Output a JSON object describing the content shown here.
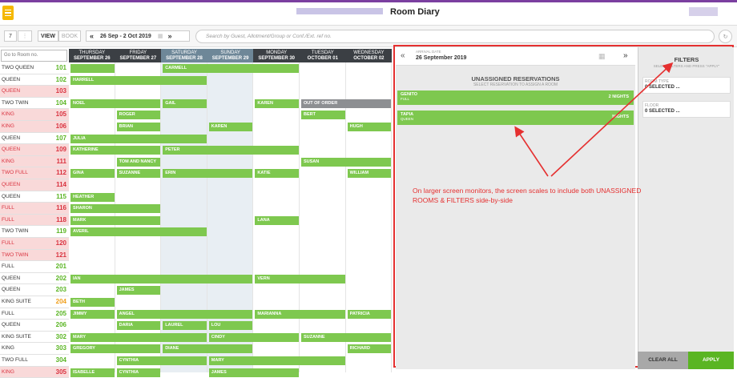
{
  "app": {
    "title": "Room Diary"
  },
  "toolbar": {
    "count": "7",
    "view": "VIEW",
    "book": "BOOK",
    "date_range": "26 Sep - 2 Oct 2019",
    "search_placeholder": "Go to Room no.",
    "search_main": "Search by Guest, Allotment/Group or Conf./Ext. ref no."
  },
  "days": [
    {
      "d": "THURSDAY",
      "n": "SEPTEMBER 26",
      "wk": false
    },
    {
      "d": "FRIDAY",
      "n": "SEPTEMBER 27",
      "wk": false
    },
    {
      "d": "SATURDAY",
      "n": "SEPTEMBER 28",
      "wk": true
    },
    {
      "d": "SUNDAY",
      "n": "SEPTEMBER 29",
      "wk": true
    },
    {
      "d": "MONDAY",
      "n": "SEPTEMBER 30",
      "wk": false
    },
    {
      "d": "TUESDAY",
      "n": "OCTOBER 01",
      "wk": false
    },
    {
      "d": "WEDNESDAY",
      "n": "OCTOBER 02",
      "wk": false
    }
  ],
  "rooms": [
    {
      "t": "TWO QUEEN",
      "n": "101",
      "c": "g",
      "d": false
    },
    {
      "t": "QUEEN",
      "n": "102",
      "c": "g",
      "d": false
    },
    {
      "t": "QUEEN",
      "n": "103",
      "c": "r",
      "d": true
    },
    {
      "t": "TWO TWIN",
      "n": "104",
      "c": "g",
      "d": false
    },
    {
      "t": "KING",
      "n": "105",
      "c": "r",
      "d": true
    },
    {
      "t": "KING",
      "n": "106",
      "c": "r",
      "d": true
    },
    {
      "t": "QUEEN",
      "n": "107",
      "c": "g",
      "d": false
    },
    {
      "t": "QUEEN",
      "n": "109",
      "c": "r",
      "d": true
    },
    {
      "t": "KING",
      "n": "111",
      "c": "r",
      "d": true
    },
    {
      "t": "TWO FULL",
      "n": "112",
      "c": "r",
      "d": true
    },
    {
      "t": "QUEEN",
      "n": "114",
      "c": "r",
      "d": true
    },
    {
      "t": "QUEEN",
      "n": "115",
      "c": "g",
      "d": false
    },
    {
      "t": "FULL",
      "n": "116",
      "c": "r",
      "d": true
    },
    {
      "t": "FULL",
      "n": "118",
      "c": "r",
      "d": true
    },
    {
      "t": "TWO TWIN",
      "n": "119",
      "c": "g",
      "d": false
    },
    {
      "t": "FULL",
      "n": "120",
      "c": "r",
      "d": true
    },
    {
      "t": "TWO TWIN",
      "n": "121",
      "c": "r",
      "d": true
    },
    {
      "t": "FULL",
      "n": "201",
      "c": "g",
      "d": false
    },
    {
      "t": "QUEEN",
      "n": "202",
      "c": "g",
      "d": false
    },
    {
      "t": "QUEEN",
      "n": "203",
      "c": "g",
      "d": false
    },
    {
      "t": "KING SUITE",
      "n": "204",
      "c": "o",
      "d": false
    },
    {
      "t": "FULL",
      "n": "205",
      "c": "g",
      "d": false
    },
    {
      "t": "QUEEN",
      "n": "206",
      "c": "g",
      "d": false
    },
    {
      "t": "KING SUITE",
      "n": "302",
      "c": "g",
      "d": false
    },
    {
      "t": "KING",
      "n": "303",
      "c": "g",
      "d": false
    },
    {
      "t": "TWO FULL",
      "n": "304",
      "c": "g",
      "d": false
    },
    {
      "t": "KING",
      "n": "305",
      "c": "r",
      "d": true
    }
  ],
  "bookings": [
    {
      "r": 0,
      "s": 0,
      "e": 1,
      "g": "",
      "x": 5
    },
    {
      "r": 0,
      "s": 2,
      "e": 5,
      "g": "CARMELL"
    },
    {
      "r": 1,
      "s": 0,
      "e": 3,
      "g": "HARRELL"
    },
    {
      "r": 3,
      "s": 0,
      "e": 2,
      "g": "NOEL"
    },
    {
      "r": 3,
      "s": 2,
      "e": 3,
      "g": "GAIL"
    },
    {
      "r": 3,
      "s": 4,
      "e": 5,
      "g": "KAREN"
    },
    {
      "r": 3,
      "s": 5,
      "e": 7,
      "g": "OUT OF ORDER",
      "gray": true
    },
    {
      "r": 4,
      "s": 1,
      "e": 2,
      "g": "ROGER"
    },
    {
      "r": 4,
      "s": 5,
      "e": 6,
      "g": "BERT"
    },
    {
      "r": 5,
      "s": 1,
      "e": 2,
      "g": "BRIAN"
    },
    {
      "r": 5,
      "s": 3,
      "e": 4,
      "g": "KAREN"
    },
    {
      "r": 5,
      "s": 6,
      "e": 7,
      "g": "HUGH"
    },
    {
      "r": 6,
      "s": 0,
      "e": 3,
      "g": "JULIA"
    },
    {
      "r": 7,
      "s": 0,
      "e": 2,
      "g": "KATHERINE"
    },
    {
      "r": 7,
      "s": 2,
      "e": 5,
      "g": "PETER"
    },
    {
      "r": 8,
      "s": 1,
      "e": 2,
      "g": "TOM AND NANCY"
    },
    {
      "r": 8,
      "s": 5,
      "e": 7,
      "g": "SUSAN"
    },
    {
      "r": 9,
      "s": 0,
      "e": 1,
      "g": "GINA"
    },
    {
      "r": 9,
      "s": 1,
      "e": 2,
      "g": "SUZANNE"
    },
    {
      "r": 9,
      "s": 2,
      "e": 4,
      "g": "ERIN"
    },
    {
      "r": 9,
      "s": 4,
      "e": 5,
      "g": "KATIE"
    },
    {
      "r": 9,
      "s": 6,
      "e": 7,
      "g": "WILLIAM"
    },
    {
      "r": 11,
      "s": 0,
      "e": 1,
      "g": "HEATHER"
    },
    {
      "r": 12,
      "s": 0,
      "e": 2,
      "g": "SHARON"
    },
    {
      "r": 13,
      "s": 0,
      "e": 2,
      "g": "MARK"
    },
    {
      "r": 13,
      "s": 4,
      "e": 5,
      "g": "LANA"
    },
    {
      "r": 14,
      "s": 0,
      "e": 3,
      "g": "AVERIL"
    },
    {
      "r": 18,
      "s": 0,
      "e": 4,
      "g": "IAN"
    },
    {
      "r": 18,
      "s": 4,
      "e": 6,
      "g": "VERN"
    },
    {
      "r": 19,
      "s": 1,
      "e": 2,
      "g": "JAMES"
    },
    {
      "r": 20,
      "s": 0,
      "e": 1,
      "g": "BETH"
    },
    {
      "r": 21,
      "s": 0,
      "e": 1,
      "g": "JIMMY"
    },
    {
      "r": 21,
      "s": 1,
      "e": 4,
      "g": "ANGEL"
    },
    {
      "r": 21,
      "s": 4,
      "e": 6,
      "g": "MARIANNA"
    },
    {
      "r": 21,
      "s": 6,
      "e": 7,
      "g": "PATRICIA"
    },
    {
      "r": 22,
      "s": 1,
      "e": 2,
      "g": "DARIA"
    },
    {
      "r": 22,
      "s": 2,
      "e": 3,
      "g": "LAUREL"
    },
    {
      "r": 22,
      "s": 3,
      "e": 4,
      "g": "LOU"
    },
    {
      "r": 23,
      "s": 0,
      "e": 3,
      "g": "MARY"
    },
    {
      "r": 23,
      "s": 3,
      "e": 5,
      "g": "CINDY"
    },
    {
      "r": 23,
      "s": 5,
      "e": 7,
      "g": "SUZANNE"
    },
    {
      "r": 24,
      "s": 0,
      "e": 2,
      "g": "GREGORY"
    },
    {
      "r": 24,
      "s": 2,
      "e": 4,
      "g": "DIANE"
    },
    {
      "r": 24,
      "s": 6,
      "e": 7,
      "g": "RICHARD"
    },
    {
      "r": 25,
      "s": 1,
      "e": 3,
      "g": "CYNTHIA"
    },
    {
      "r": 25,
      "s": 3,
      "e": 6,
      "g": "MARY"
    },
    {
      "r": 26,
      "s": 0,
      "e": 1,
      "g": "ISABELLE"
    },
    {
      "r": 26,
      "s": 1,
      "e": 2,
      "g": "CYNTHIA"
    },
    {
      "r": 26,
      "s": 3,
      "e": 5,
      "g": "JAMES"
    }
  ],
  "unassigned": {
    "arrival_label": "ARRIVAL DATE",
    "arrival": "26 September 2019",
    "title": "UNASSIGNED RESERVATIONS",
    "sub": "SELECT RESERVATION TO ASSIGN A ROOM",
    "items": [
      {
        "name": "GENITO",
        "type": "FULL",
        "nights": "2 NIGHTS"
      },
      {
        "name": "TAPIA",
        "type": "QUEEN",
        "nights": "NIGHTS"
      }
    ]
  },
  "filters": {
    "title": "FILTERS",
    "sub": "SELECT FILTERS AND PRESS \"APPLY\"",
    "room_type_label": "ROOM TYPE",
    "room_type": "0 SELECTED ...",
    "floor_label": "FLOOR",
    "floor": "0 SELECTED ...",
    "clear": "CLEAR ALL",
    "apply": "APPLY"
  },
  "annotation": "On larger screen monitors, the screen scales to include both UNASSIGNED ROOMS & FILTERS side-by-side",
  "colors": {
    "green": "#7ec84f",
    "red": "#e53030",
    "purple": "#7b3fa0",
    "gold": "#f5b800"
  }
}
